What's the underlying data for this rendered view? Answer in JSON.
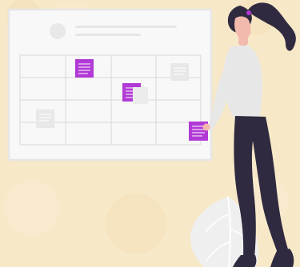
{
  "scene": {
    "subject": "person-arranging-sticky-notes-on-calendar-board",
    "colors": {
      "background": "#f7e8c8",
      "board": "#f8f8f8",
      "board_border": "#e6e6e6",
      "grid": "#d9d9d9",
      "sticky_accent": "#b13ad6",
      "sticky_neutral": "#e8e8e8",
      "skin": "#f2b9ad",
      "hair": "#2f2a3f",
      "shirt": "#e7e7e7",
      "pants": "#2f2a3f",
      "leaf": "#efefef"
    },
    "icons": {
      "avatar": "user-avatar-icon",
      "sticky_note": "sticky-note-icon",
      "leaf": "leaf-icon"
    }
  }
}
